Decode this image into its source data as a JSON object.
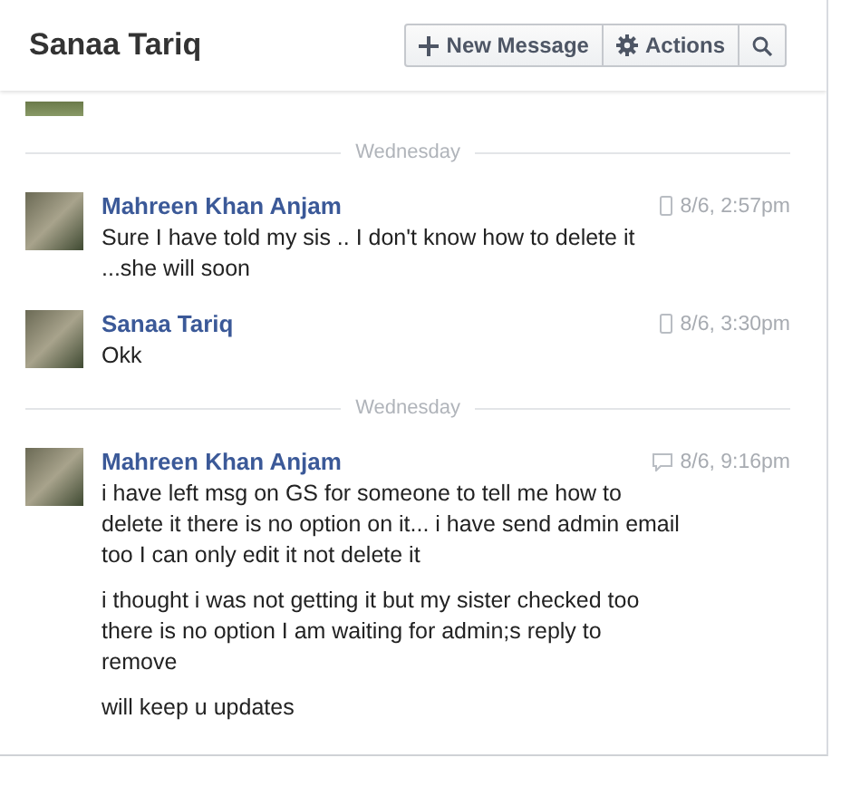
{
  "header": {
    "title": "Sanaa Tariq",
    "buttons": [
      {
        "kind": "plus",
        "label": "New Message"
      },
      {
        "kind": "gear",
        "label": "Actions"
      },
      {
        "kind": "search"
      }
    ]
  },
  "thread": [
    {
      "kind": "partial"
    },
    {
      "kind": "divider",
      "label": "Wednesday"
    },
    {
      "kind": "message",
      "sender": "Mahreen Khan Anjam",
      "via": {
        "kind": "mobile"
      },
      "time": "8/6, 2:57pm",
      "paragraphs": [
        "Sure I have told my sis .. I don't know how to delete it ...she will soon"
      ]
    },
    {
      "kind": "message",
      "sender": "Sanaa Tariq",
      "via": {
        "kind": "mobile"
      },
      "time": "8/6, 3:30pm",
      "paragraphs": [
        "Okk"
      ]
    },
    {
      "kind": "divider",
      "label": "Wednesday"
    },
    {
      "kind": "message",
      "sender": "Mahreen Khan Anjam",
      "via": {
        "kind": "web"
      },
      "time": "8/6, 9:16pm",
      "paragraphs": [
        "i have left msg on GS for someone to tell me how to delete it there is no option on it... i have send admin email too I can only edit it not delete it",
        "i thought i was not getting it but my sister checked too there is no option I am waiting for admin;s reply to remove",
        "will keep u updates"
      ]
    }
  ]
}
